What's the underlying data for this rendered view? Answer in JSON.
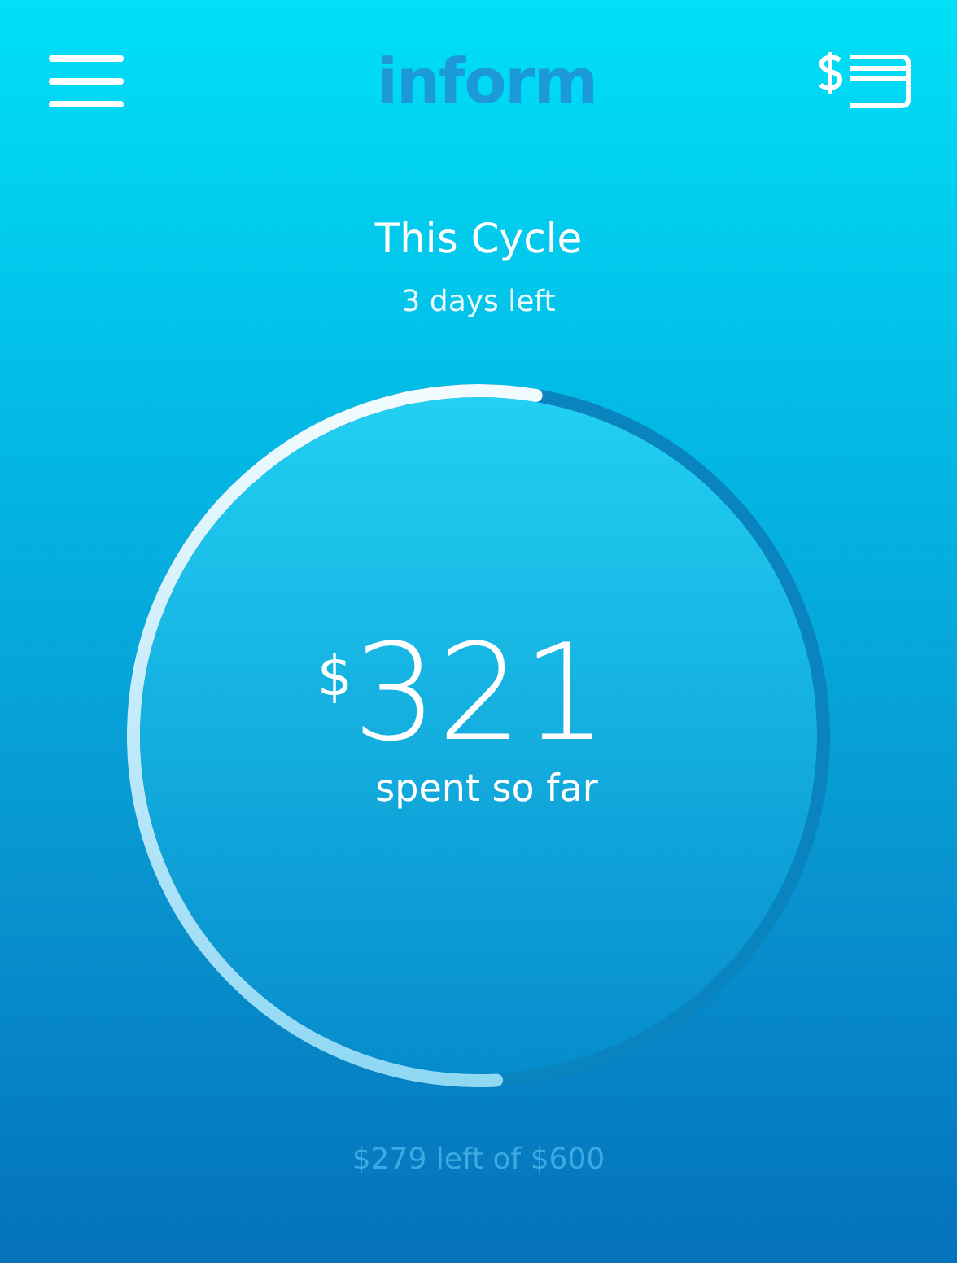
{
  "header": {
    "logo": "inform"
  },
  "cycle": {
    "title": "This Cycle",
    "days_left": "3 days left",
    "currency": "$",
    "amount": "321",
    "caption": "spent so far",
    "level": 0.535,
    "remaining": "$279 left of $600"
  }
}
